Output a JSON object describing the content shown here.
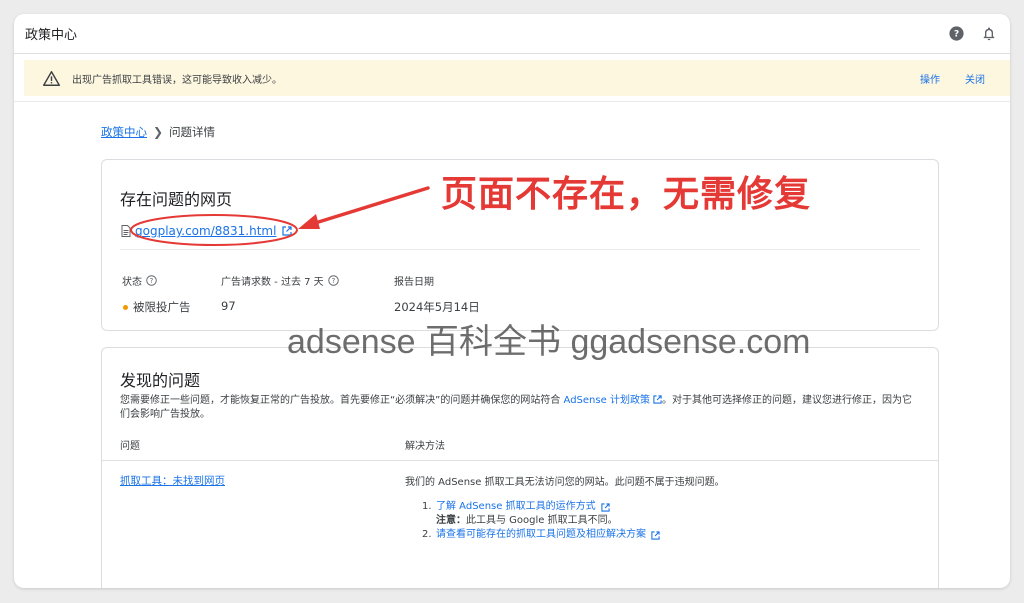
{
  "topbar": {
    "title": "政策中心",
    "help_icon": "help-icon",
    "bell_icon": "bell-icon"
  },
  "banner": {
    "message": "出现广告抓取工具错误，这可能导致收入减少。",
    "action": "操作",
    "close": "关闭",
    "color": "#fef7e0"
  },
  "breadcrumb": {
    "parent": "政策中心",
    "current": "问题详情"
  },
  "card1": {
    "title": "存在问题的网页",
    "url": "gogplay.com/8831.html",
    "status_label": "状态",
    "requests_label": "广告请求数 - 过去 7 天",
    "date_label": "报告日期",
    "status_value": "被限投广告",
    "requests_value": "97",
    "date_value": "2024年5月14日"
  },
  "card2": {
    "title": "发现的问题",
    "desc_1": "您需要修正一些问题，才能恢复正常的广告投放。首先要修正“必须解决”的问题并确保您的网站符合 ",
    "desc_link": "AdSense 计划政策",
    "desc_2": "。对于其他可选择修正的问题，建议您进行修正，因为它们会影响广告投放。",
    "col_issue": "问题",
    "col_solution": "解决方法",
    "issue": "抓取工具：未找到网页",
    "solution_text": "我们的 AdSense 抓取工具无法访问您的网站。此问题不属于违规问题。",
    "step1": "了解 AdSense 抓取工具的运作方式",
    "note_label": "注意：",
    "note_text": "此工具与 Google 抓取工具不同。",
    "step2": "请查看可能存在的抓取工具问题及相应解决方案",
    "num1": "1.",
    "num2": "2."
  },
  "annotation": {
    "text": "页面不存在，无需修复",
    "color": "#e53935"
  },
  "watermark": {
    "text": "adsense 百科全书 ggadsense.com"
  }
}
